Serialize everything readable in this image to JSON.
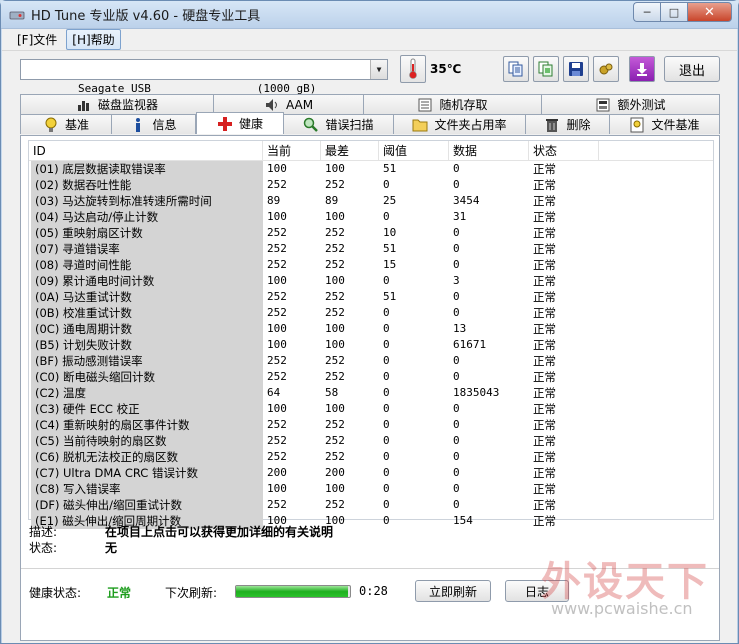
{
  "window": {
    "title": "HD Tune 专业版 v4.60 - 硬盘专业工具",
    "minimize": "─",
    "maximize": "□",
    "close": "✕"
  },
  "menu": [
    "[F]文件",
    "[H]帮助"
  ],
  "toolbar": {
    "drive": "Seagate USB                (1000 gB)",
    "temperature": "35℃",
    "exit_label": "退出",
    "icons": [
      "copy-text-icon",
      "copy-screen-icon",
      "save-icon",
      "options-icon",
      "download-icon"
    ]
  },
  "tabs_top": [
    {
      "label": "磁盘监视器",
      "icon": "bar-chart-icon"
    },
    {
      "label": "AAM",
      "icon": "speaker-icon"
    },
    {
      "label": "随机存取",
      "icon": "random-access-icon"
    },
    {
      "label": "额外测试",
      "icon": "extra-test-icon"
    }
  ],
  "tabs_bottom": [
    {
      "label": "基准",
      "icon": "lightbulb-icon"
    },
    {
      "label": "信息",
      "icon": "info-icon"
    },
    {
      "label": "健康",
      "icon": "health-cross-icon"
    },
    {
      "label": "错误扫描",
      "icon": "magnifier-icon"
    },
    {
      "label": "文件夹占用率",
      "icon": "folder-icon"
    },
    {
      "label": "删除",
      "icon": "trash-icon"
    },
    {
      "label": "文件基准",
      "icon": "file-benchmark-icon"
    }
  ],
  "selected_tab": "健康",
  "table": {
    "headers": [
      "ID",
      "当前",
      "最差",
      "阈值",
      "数据",
      "状态"
    ],
    "rows": [
      [
        "(01) 底层数据读取错误率",
        "100",
        "100",
        "51",
        "0",
        "正常"
      ],
      [
        "(02) 数据吞吐性能",
        "252",
        "252",
        "0",
        "0",
        "正常"
      ],
      [
        "(03) 马达旋转到标准转速所需时间",
        "89",
        "89",
        "25",
        "3454",
        "正常"
      ],
      [
        "(04) 马达启动/停止计数",
        "100",
        "100",
        "0",
        "31",
        "正常"
      ],
      [
        "(05) 重映射扇区计数",
        "252",
        "252",
        "10",
        "0",
        "正常"
      ],
      [
        "(07) 寻道错误率",
        "252",
        "252",
        "51",
        "0",
        "正常"
      ],
      [
        "(08) 寻道时间性能",
        "252",
        "252",
        "15",
        "0",
        "正常"
      ],
      [
        "(09) 累计通电时间计数",
        "100",
        "100",
        "0",
        "3",
        "正常"
      ],
      [
        "(0A) 马达重试计数",
        "252",
        "252",
        "51",
        "0",
        "正常"
      ],
      [
        "(0B) 校准重试计数",
        "252",
        "252",
        "0",
        "0",
        "正常"
      ],
      [
        "(0C) 通电周期计数",
        "100",
        "100",
        "0",
        "13",
        "正常"
      ],
      [
        "(B5) 计划失败计数",
        "100",
        "100",
        "0",
        "61671",
        "正常"
      ],
      [
        "(BF) 振动感测错误率",
        "252",
        "252",
        "0",
        "0",
        "正常"
      ],
      [
        "(C0) 断电磁头缩回计数",
        "252",
        "252",
        "0",
        "0",
        "正常"
      ],
      [
        "(C2) 温度",
        "64",
        "58",
        "0",
        "1835043",
        "正常"
      ],
      [
        "(C3) 硬件 ECC 校正",
        "100",
        "100",
        "0",
        "0",
        "正常"
      ],
      [
        "(C4) 重新映射的扇区事件计数",
        "252",
        "252",
        "0",
        "0",
        "正常"
      ],
      [
        "(C5) 当前待映射的扇区数",
        "252",
        "252",
        "0",
        "0",
        "正常"
      ],
      [
        "(C6) 脱机无法校正的扇区数",
        "252",
        "252",
        "0",
        "0",
        "正常"
      ],
      [
        "(C7) Ultra DMA CRC 错误计数",
        "200",
        "200",
        "0",
        "0",
        "正常"
      ],
      [
        "(C8) 写入错误率",
        "100",
        "100",
        "0",
        "0",
        "正常"
      ],
      [
        "(DF) 磁头伸出/缩回重试计数",
        "252",
        "252",
        "0",
        "0",
        "正常"
      ],
      [
        "(E1) 磁头伸出/缩回周期计数",
        "100",
        "100",
        "0",
        "154",
        "正常"
      ]
    ]
  },
  "description": {
    "label": "描述:",
    "value": "在项目上点击可以获得更加详细的有关说明"
  },
  "status": {
    "label": "状态:",
    "value": "无"
  },
  "statusbar": {
    "health_label": "健康状态:",
    "health_value": "正常",
    "refresh_label": "下次刷新:",
    "progress_fraction": 0.98,
    "time": "0:28",
    "refresh_button": "立即刷新",
    "log_button": "日志"
  },
  "watermark": {
    "logo": "外设天下",
    "url": "www.pcwaishe.cn"
  },
  "colors": {
    "health_ok": "#1e9d1e",
    "progress": "#1fb01f"
  }
}
